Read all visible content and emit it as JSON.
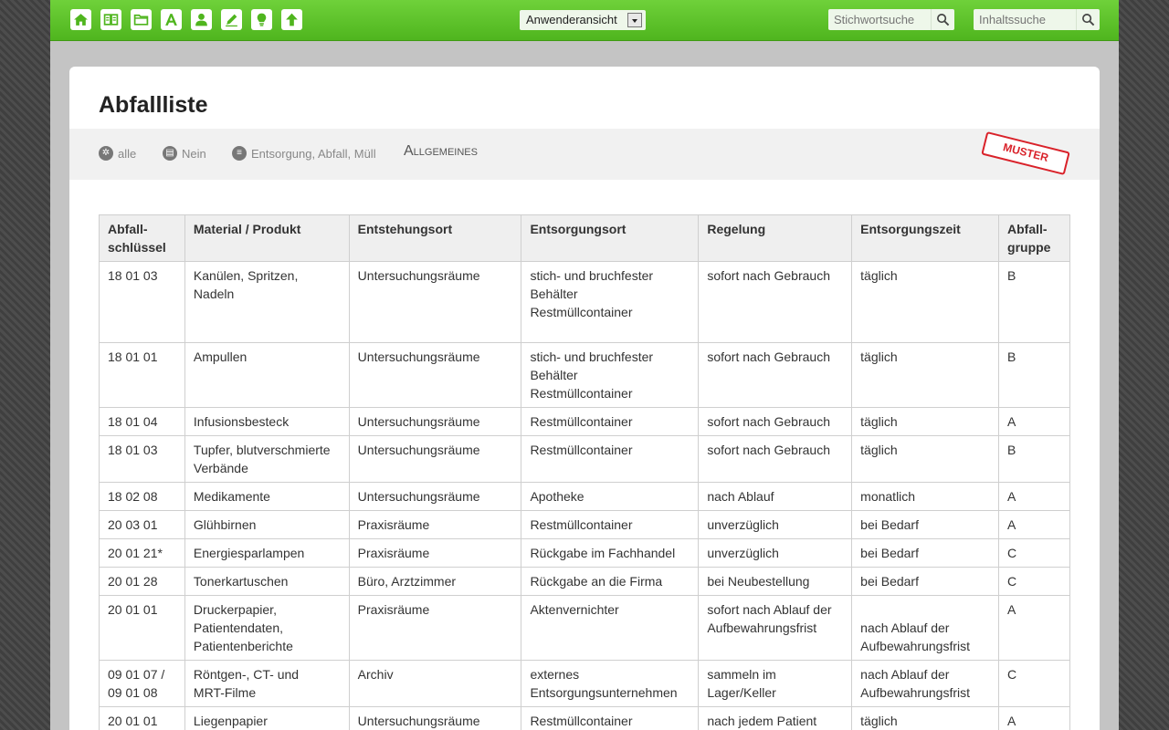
{
  "topbar": {
    "icons": [
      "home-icon",
      "book-icon",
      "folder-icon",
      "font-icon",
      "user-icon",
      "pencil-icon",
      "lightbulb-icon",
      "arrow-up-icon"
    ],
    "view_select": {
      "value": "Anwenderansicht"
    },
    "keyword_search": {
      "placeholder": "Stichwortsuche"
    },
    "content_search": {
      "placeholder": "Inhaltssuche"
    },
    "accent_color": "#5cc22a"
  },
  "page": {
    "title": "Abfallliste",
    "meta": {
      "scope": "alle",
      "print": "Nein",
      "tags": "Entsorgung, Abfall, Müll",
      "category": "Allgemeines"
    },
    "stamp": "MUSTER",
    "stamp_color": "#d9222a"
  },
  "table": {
    "headers": [
      "Abfall-\nschlüssel",
      "Material / Produkt",
      "Entstehungsort",
      "Entsorgungsort",
      "Regelung",
      "Entsorgungszeit",
      "Abfall-\ngruppe"
    ],
    "rows": [
      [
        "18 01 03",
        "Kanülen, Spritzen,\nNadeln",
        "Untersuchungsräume",
        "stich- und bruchfester\nBehälter\nRestmüllcontainer",
        "sofort nach Gebrauch",
        "täglich",
        "B"
      ],
      [
        "18 01 01",
        "Ampullen",
        "Untersuchungsräume",
        "stich- und bruchfester\nBehälter\nRestmüllcontainer",
        "sofort nach Gebrauch",
        "täglich",
        "B"
      ],
      [
        "18 01 04",
        "Infusionsbesteck",
        "Untersuchungsräume",
        "Restmüllcontainer",
        "sofort nach Gebrauch",
        "täglich",
        "A"
      ],
      [
        "18 01 03",
        "Tupfer, blutverschmierte\nVerbände",
        "Untersuchungsräume",
        "Restmüllcontainer",
        "sofort nach Gebrauch",
        "täglich",
        "B"
      ],
      [
        "18 02 08",
        "Medikamente",
        "Untersuchungsräume",
        "Apotheke",
        "nach Ablauf",
        "monatlich",
        "A"
      ],
      [
        "20 03 01",
        "Glühbirnen",
        "Praxisräume",
        "Restmüllcontainer",
        "unverzüglich",
        "bei Bedarf",
        "A"
      ],
      [
        "20 01 21*",
        "Energiesparlampen",
        "Praxisräume",
        "Rückgabe im Fachhandel",
        "unverzüglich",
        "bei Bedarf",
        "C"
      ],
      [
        "20 01 28",
        "Tonerkartuschen",
        "Büro, Arztzimmer",
        "Rückgabe an die Firma",
        "bei Neubestellung",
        "bei Bedarf",
        "C"
      ],
      [
        "20 01 01",
        "Druckerpapier,\nPatientendaten,\nPatientenberichte",
        "Praxisräume",
        "Aktenvernichter",
        "sofort nach Ablauf der\nAufbewahrungsfrist",
        "\nnach Ablauf der\nAufbewahrungsfrist",
        "A"
      ],
      [
        "09 01 07 /\n09 01 08",
        "Röntgen-, CT- und\nMRT-Filme",
        "Archiv",
        "externes\nEntsorgungsunternehmen",
        "sammeln im\nLager/Keller",
        "nach Ablauf der\nAufbewahrungsfrist",
        "C"
      ],
      [
        "20 01 01",
        "Liegenpapier",
        "Untersuchungsräume",
        "Restmüllcontainer",
        "nach jedem Patient",
        "täglich",
        "A"
      ]
    ]
  }
}
